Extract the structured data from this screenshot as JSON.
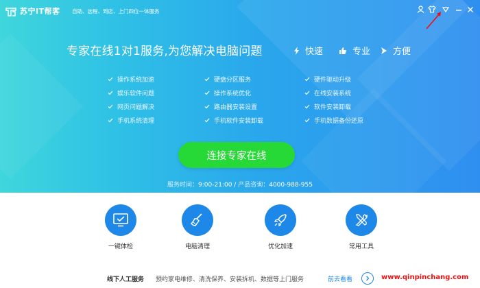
{
  "app": {
    "name": "苏宁IT帮客",
    "slogan": "自助、远程、到店、上门四位一体服务"
  },
  "titlebar": {
    "icons": [
      "user-icon",
      "shirt-skin-icon",
      "menu-triangle-icon",
      "minimize-icon",
      "close-icon"
    ]
  },
  "hero": {
    "headline": "专家在线1对1服务,为您解决电脑问题",
    "features": [
      {
        "label": "快速",
        "icon": "lightning-icon"
      },
      {
        "label": "专业",
        "icon": "thumbs-up-icon"
      },
      {
        "label": "方便",
        "icon": "arrow-right-icon"
      }
    ],
    "services": [
      [
        "操作系统加速",
        "硬盘分区服务",
        "硬件驱动升级"
      ],
      [
        "娱乐软件问题",
        "操作系统优化",
        "在线安装系统"
      ],
      [
        "网页问题解决",
        "路由器安装设置",
        "软件安装卸载"
      ],
      [
        "手机系统清理",
        "手机软件安装卸载",
        "手机数据备份还原"
      ]
    ],
    "connect_label": "连接专家在线",
    "service_time_label": "服务时间：",
    "service_time": "9:00-21:00",
    "separator": " / ",
    "consult_label": "产品咨询：",
    "phone": "4000-988-955"
  },
  "tools": [
    {
      "label": "一键体检",
      "icon": "monitor-check-icon"
    },
    {
      "label": "电脑清理",
      "icon": "broom-icon"
    },
    {
      "label": "优化加速",
      "icon": "rocket-icon"
    },
    {
      "label": "常用工具",
      "icon": "tools-icon"
    }
  ],
  "bottom": {
    "offline_title": "线下人工服务",
    "offline_desc": "预约家电维修、清洗保养、安装拆机、数据等上门服务",
    "look_label": "前去看看",
    "watermark": "www.qinpinchang.com"
  },
  "colors": {
    "hero_start": "#3fd6dc",
    "hero_end": "#2f8ff0",
    "connect_green": "#27d936",
    "tool_blue": "#1e88e8",
    "watermark_red": "#e11111"
  }
}
